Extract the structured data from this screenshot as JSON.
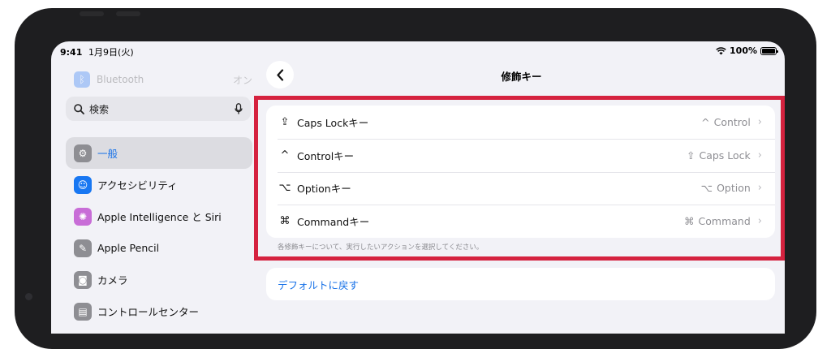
{
  "status_bar": {
    "time": "9:41",
    "date": "1月9日(火)",
    "battery_label": "100%",
    "battery_level": 1.0
  },
  "sidebar": {
    "bluetooth": {
      "label": "Bluetooth",
      "value": "オン"
    },
    "search": {
      "placeholder": "検索"
    },
    "items": [
      {
        "label": "一般",
        "icon": "gear-icon",
        "color": "#8e8e93",
        "selected": true
      },
      {
        "label": "アクセシビリティ",
        "icon": "accessibility-icon",
        "color": "#1877f2",
        "selected": false
      },
      {
        "label": "Apple Intelligence と Siri",
        "icon": "apple-intelligence-icon",
        "color": "#c86dd7",
        "selected": false
      },
      {
        "label": "Apple Pencil",
        "icon": "pencil-icon",
        "color": "#8e8e93",
        "selected": false
      },
      {
        "label": "カメラ",
        "icon": "camera-icon",
        "color": "#8e8e93",
        "selected": false
      },
      {
        "label": "コントロールセンター",
        "icon": "control-center-icon",
        "color": "#8e8e93",
        "selected": false
      }
    ]
  },
  "content": {
    "title": "修飾キー",
    "rows": [
      {
        "symbol": "⇪",
        "label": "Caps Lockキー",
        "value_symbol": "^",
        "value": "Control"
      },
      {
        "symbol": "^",
        "label": "Controlキー",
        "value_symbol": "⇪",
        "value": "Caps Lock"
      },
      {
        "symbol": "⌥",
        "label": "Optionキー",
        "value_symbol": "⌥",
        "value": "Option"
      },
      {
        "symbol": "⌘",
        "label": "Commandキー",
        "value_symbol": "⌘",
        "value": "Command"
      }
    ],
    "footnote": "各修飾キーについて、実行したいアクションを選択してください。",
    "default_button": "デフォルトに戻す"
  },
  "colors": {
    "accent": "#1a73e8",
    "highlight": "#d5223f",
    "background": "#f2f2f7"
  }
}
